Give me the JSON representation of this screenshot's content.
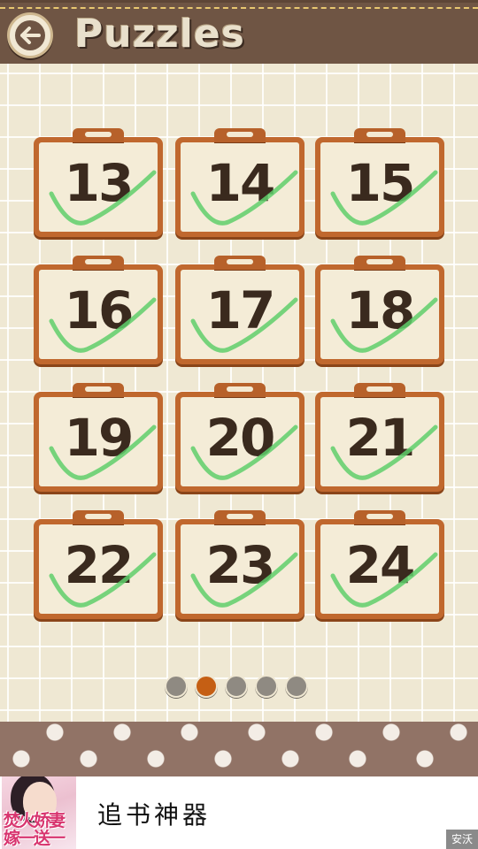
{
  "header": {
    "title": "Puzzles",
    "back_icon": "back-arrow-icon"
  },
  "levels": [
    {
      "number": "13",
      "completed": true
    },
    {
      "number": "14",
      "completed": true
    },
    {
      "number": "15",
      "completed": true
    },
    {
      "number": "16",
      "completed": true
    },
    {
      "number": "17",
      "completed": true
    },
    {
      "number": "18",
      "completed": true
    },
    {
      "number": "19",
      "completed": true
    },
    {
      "number": "20",
      "completed": true
    },
    {
      "number": "21",
      "completed": true
    },
    {
      "number": "22",
      "completed": true
    },
    {
      "number": "23",
      "completed": true
    },
    {
      "number": "24",
      "completed": true
    }
  ],
  "pagination": {
    "total_pages": 5,
    "current_page": 2
  },
  "ad": {
    "thumb_text_line1": "焚火娇妻",
    "thumb_text_line2": "嫁一送一",
    "title": "追书神器",
    "badge": "安沃"
  },
  "colors": {
    "header_bg": "#6f5544",
    "card_frame": "#c0682e",
    "check_mark": "#5fcf6b",
    "active_dot": "#c55f14",
    "inactive_dot": "#8f8a82"
  }
}
